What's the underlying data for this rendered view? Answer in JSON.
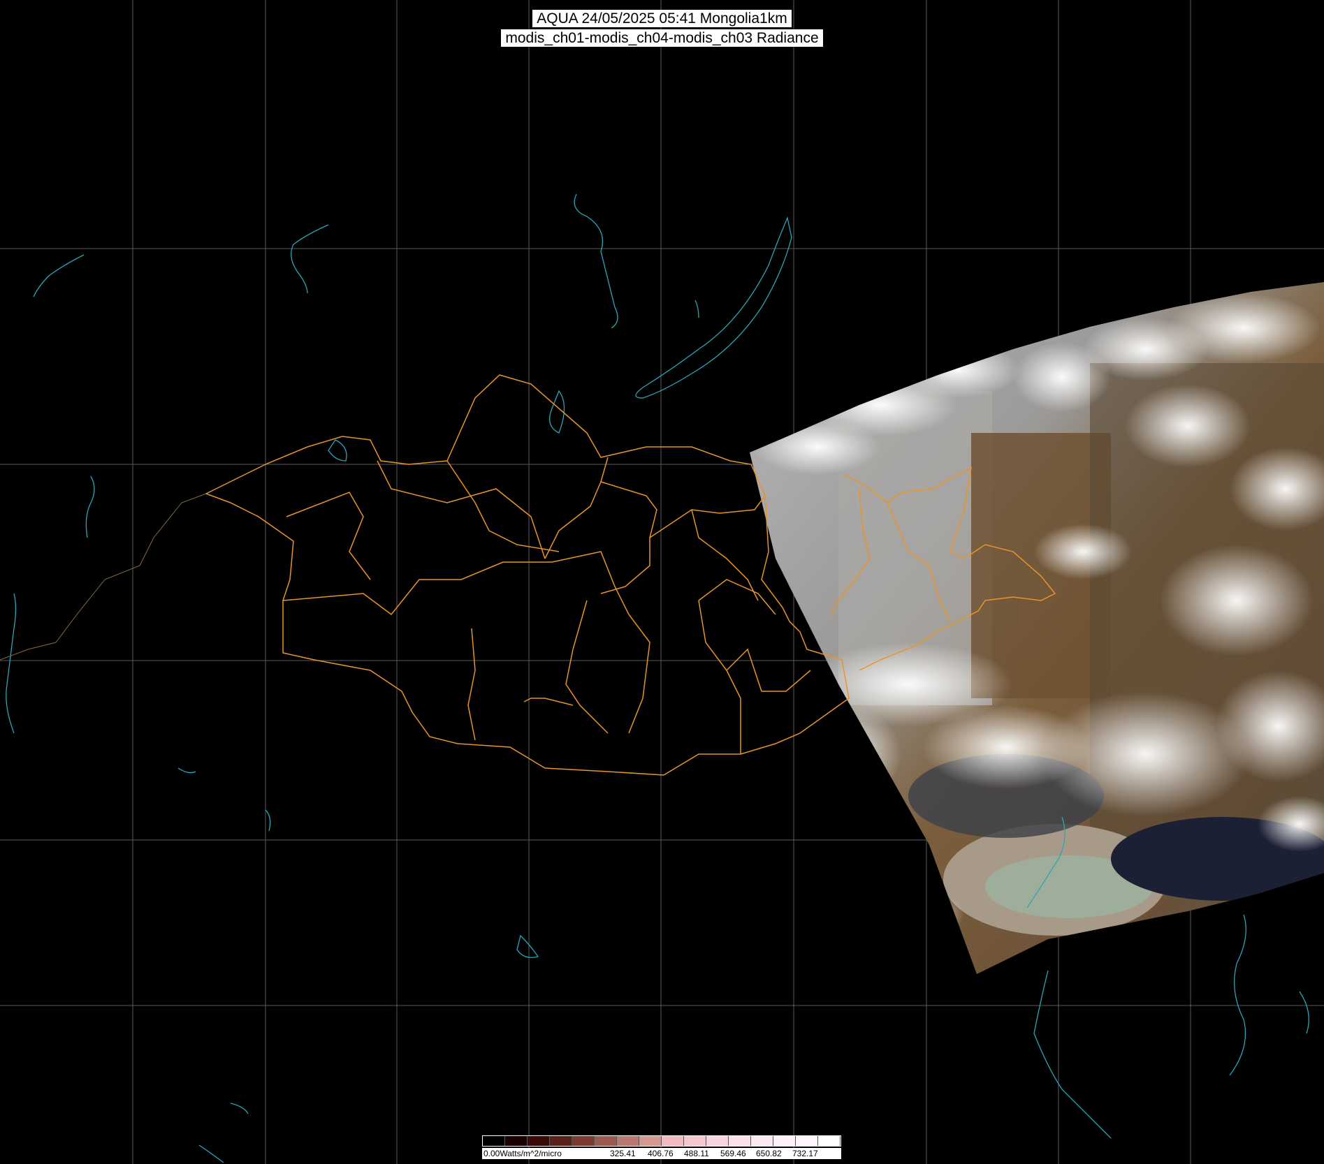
{
  "title": {
    "line1": "AQUA 24/05/2025 05:41 Mongolia1km",
    "line2": "modis_ch01-modis_ch04-modis_ch03 Radiance"
  },
  "legend": {
    "first_label": "0.00Watts/m^2/micro",
    "labels": [
      "325.41",
      "406.76",
      "488.11",
      "569.46",
      "650.82",
      "732.17"
    ],
    "colors": [
      "#000000",
      "#1a0000",
      "#3a0a08",
      "#5a201a",
      "#7a3a30",
      "#9a5a50",
      "#b87870",
      "#d49890",
      "#f2b9c0",
      "#f6c6cf",
      "#f9d3dd",
      "#fce0eb",
      "#fde9f3",
      "#fff0fa",
      "#fff6fd",
      "#ffffff"
    ]
  },
  "colors": {
    "grid": "#5a5a5a",
    "border": "#e8942a",
    "coast": "#2aa6b8",
    "background": "#000000"
  }
}
